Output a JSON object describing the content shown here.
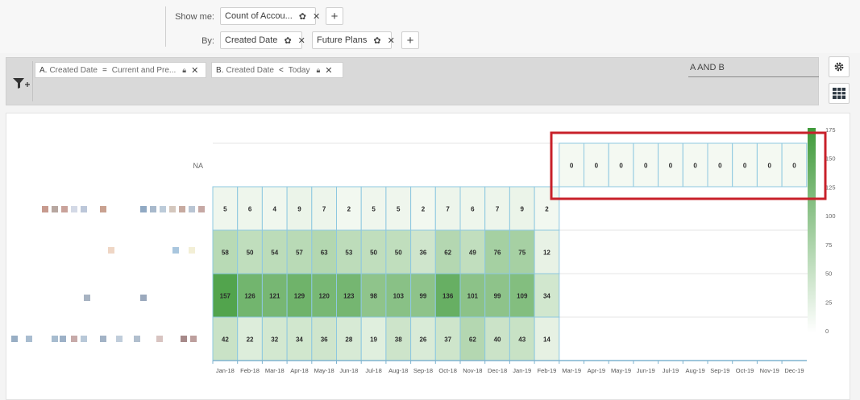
{
  "controls": {
    "show_me_label": "Show me:",
    "show_me_pill": "Count of Accou...",
    "by_label": "By:",
    "by_pills": [
      "Created Date",
      "Future Plans"
    ]
  },
  "filters": {
    "items": [
      {
        "letter": "A.",
        "field": "Created Date",
        "operator": "=",
        "value": "Current and Pre..."
      },
      {
        "letter": "B.",
        "field": "Created Date",
        "operator": "<",
        "value": "Today"
      }
    ],
    "logic": "A AND B"
  },
  "icons": {
    "gear": "gear-icon",
    "close": "close-icon",
    "plus": "plus-icon",
    "lock": "lock-icon",
    "filter": "filter-icon",
    "table": "table-view-icon"
  },
  "colors": {
    "heat_low": "#f4f9f2",
    "heat_high": "#3f9a3a",
    "grid": "#8ec8e0",
    "highlight": "#c8202a"
  },
  "chart_data": {
    "type": "heatmap",
    "x": [
      "Jan-18",
      "Feb-18",
      "Mar-18",
      "Apr-18",
      "May-18",
      "Jun-18",
      "Jul-18",
      "Aug-18",
      "Sep-18",
      "Oct-18",
      "Nov-18",
      "Dec-18",
      "Jan-19",
      "Feb-19",
      "Mar-19",
      "Apr-19",
      "May-19",
      "Jun-19",
      "Jul-19",
      "Aug-19",
      "Sep-19",
      "Oct-19",
      "Nov-19",
      "Dec-19"
    ],
    "rows": [
      {
        "label": "NA",
        "values": [
          null,
          null,
          null,
          null,
          null,
          null,
          null,
          null,
          null,
          null,
          null,
          null,
          null,
          null,
          0,
          0,
          0,
          0,
          0,
          0,
          0,
          0,
          0,
          0
        ]
      },
      {
        "label": "",
        "values": [
          5,
          6,
          4,
          9,
          7,
          2,
          5,
          5,
          2,
          7,
          6,
          7,
          9,
          2,
          null,
          null,
          null,
          null,
          null,
          null,
          null,
          null,
          null,
          null
        ]
      },
      {
        "label": "",
        "values": [
          58,
          50,
          54,
          57,
          63,
          53,
          50,
          50,
          36,
          62,
          49,
          76,
          75,
          12,
          null,
          null,
          null,
          null,
          null,
          null,
          null,
          null,
          null,
          null
        ]
      },
      {
        "label": "",
        "values": [
          157,
          126,
          121,
          129,
          120,
          123,
          98,
          103,
          99,
          136,
          101,
          99,
          109,
          34,
          null,
          null,
          null,
          null,
          null,
          null,
          null,
          null,
          null,
          null
        ]
      },
      {
        "label": "",
        "values": [
          42,
          22,
          32,
          34,
          36,
          28,
          19,
          38,
          26,
          37,
          62,
          40,
          43,
          14,
          null,
          null,
          null,
          null,
          null,
          null,
          null,
          null,
          null,
          null
        ]
      }
    ],
    "legend_ticks": [
      "175",
      "150",
      "125",
      "100",
      "75",
      "50",
      "25",
      "0"
    ],
    "color_range": [
      0,
      175
    ],
    "highlighted_values": [
      0,
      0,
      0,
      0,
      0,
      0,
      0,
      0,
      0,
      0
    ]
  }
}
